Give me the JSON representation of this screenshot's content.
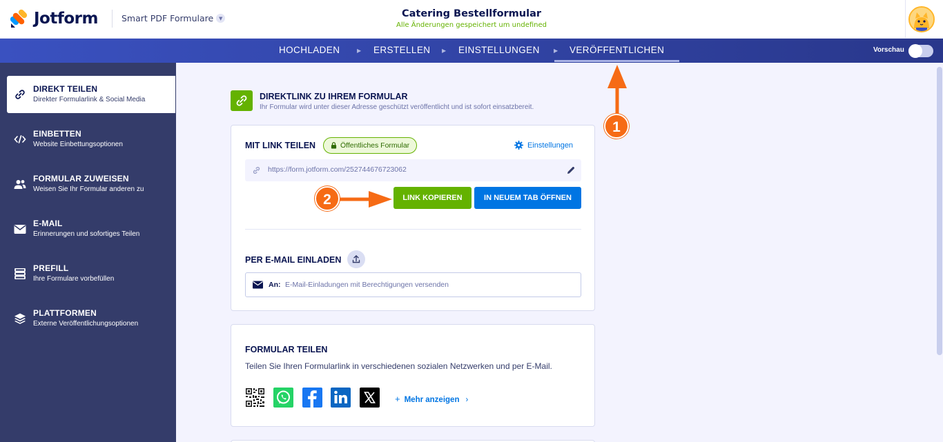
{
  "header": {
    "brand": "Jotform",
    "product": "Smart PDF Formulare",
    "form_title": "Catering Bestellformular",
    "save_status": "Alle Änderungen gespeichert um undefined"
  },
  "nav": {
    "tabs": [
      "HOCHLADEN",
      "ERSTELLEN",
      "EINSTELLUNGEN",
      "VERÖFFENTLICHEN"
    ],
    "active_tab": "VERÖFFENTLICHEN",
    "preview_label": "Vorschau",
    "preview_on": false
  },
  "sidebar": {
    "items": [
      {
        "title": "DIREKT TEILEN",
        "subtitle": "Direkter Formularlink & Social Media",
        "icon": "link-icon",
        "active": true
      },
      {
        "title": "EINBETTEN",
        "subtitle": "Website Einbettungsoptionen",
        "icon": "code-icon",
        "active": false
      },
      {
        "title": "FORMULAR ZUWEISEN",
        "subtitle": "Weisen Sie Ihr Formular anderen zu",
        "icon": "users-icon",
        "active": false
      },
      {
        "title": "E-MAIL",
        "subtitle": "Erinnerungen und sofortiges Teilen",
        "icon": "envelope-icon",
        "active": false
      },
      {
        "title": "PREFILL",
        "subtitle": "Ihre Formulare vorbefüllen",
        "icon": "prefill-icon",
        "active": false
      },
      {
        "title": "PLATTFORMEN",
        "subtitle": "Externe Veröffentlichungsoptionen",
        "icon": "layers-icon",
        "active": false
      }
    ]
  },
  "main": {
    "heading_title": "DIREKTLINK ZU IHREM FORMULAR",
    "heading_sub": "Ihr Formular wird unter dieser Adresse geschützt veröffentlicht und ist sofort einsatzbereit.",
    "link_share": {
      "label": "MIT LINK TEILEN",
      "badge": "Öffentliches Formular",
      "settings": "Einstellungen",
      "url": "https://form.jotform.com/252744676723062",
      "copy_button": "LINK KOPIEREN",
      "open_button": "IN NEUEM TAB ÖFFNEN"
    },
    "email_invite": {
      "label": "PER E-MAIL EINLADEN",
      "to_label": "An:",
      "placeholder": "E-Mail-Einladungen mit Berechtigungen versenden"
    },
    "form_share": {
      "label": "FORMULAR TEILEN",
      "description": "Teilen Sie Ihren Formularlink in verschiedenen sozialen Netzwerken und per E-Mail.",
      "socials": [
        "qr-code-icon",
        "whatsapp-icon",
        "facebook-icon",
        "linkedin-icon",
        "x-icon"
      ],
      "more": "Mehr anzeigen"
    }
  },
  "annotations": {
    "step1": "1",
    "step2": "2",
    "color": "#f66b15"
  },
  "colors": {
    "brand_green": "#64b200",
    "brand_blue": "#0075e3",
    "nav_blue": "#3a51c0",
    "sidebar": "#343c6a"
  }
}
